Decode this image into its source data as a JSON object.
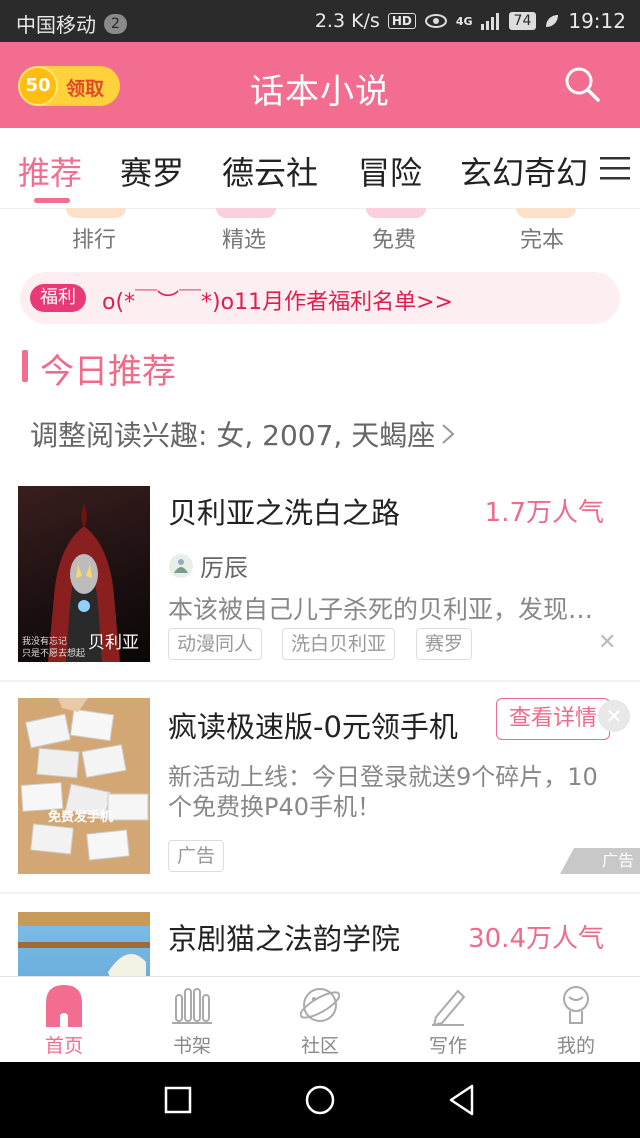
{
  "status_bar": {
    "carrier": "中国移动",
    "notif_count": "2",
    "speed": "2.3 K/s",
    "hd": "HD",
    "net": "4G",
    "battery": "74",
    "time": "19:12"
  },
  "app_bar": {
    "coins": "50",
    "claim": "领取",
    "title": "话本小说",
    "icons": {
      "search": "search-icon"
    }
  },
  "tabs": [
    {
      "label": "推荐",
      "active": true
    },
    {
      "label": "赛罗"
    },
    {
      "label": "德云社"
    },
    {
      "label": "冒险"
    },
    {
      "label": "玄幻奇幻"
    }
  ],
  "quick_links": [
    "排行",
    "精选",
    "免费",
    "完本"
  ],
  "welfare": {
    "tag": "福利",
    "text": "o(*￣︶￣*)o11月作者福利名单>>"
  },
  "section": {
    "title": "今日推荐",
    "interest": "调整阅读兴趣: 女, 2007, 天蝎座"
  },
  "books": [
    {
      "title": "贝利亚之洗白之路",
      "popularity": "1.7万人气",
      "author": "厉辰",
      "desc": "本该被自己儿子杀死的贝利亚，发现自己并没有死，而是…",
      "tags": [
        "动漫同人",
        "洗白贝利亚",
        "赛罗"
      ],
      "cover_text1": "我没有忘记",
      "cover_text2": "只是不愿去想起",
      "cover_name": "贝利亚"
    },
    {
      "title": "京剧猫之法韵学院",
      "popularity": "30.4万人气"
    }
  ],
  "ad": {
    "title": "疯读极速版-0元领手机",
    "button": "查看详情",
    "desc": "新活动上线：今日登录就送9个碎片，10个免费换P40手机！",
    "tag": "广告",
    "label": "广告",
    "cover_text": "免费发手机"
  },
  "bottom_nav": [
    {
      "label": "首页",
      "active": true
    },
    {
      "label": "书架"
    },
    {
      "label": "社区"
    },
    {
      "label": "写作"
    },
    {
      "label": "我的"
    }
  ],
  "colors": {
    "brand": "#f26d8f",
    "accent_text": "#f06a8a",
    "coin": "#ffd23c"
  }
}
